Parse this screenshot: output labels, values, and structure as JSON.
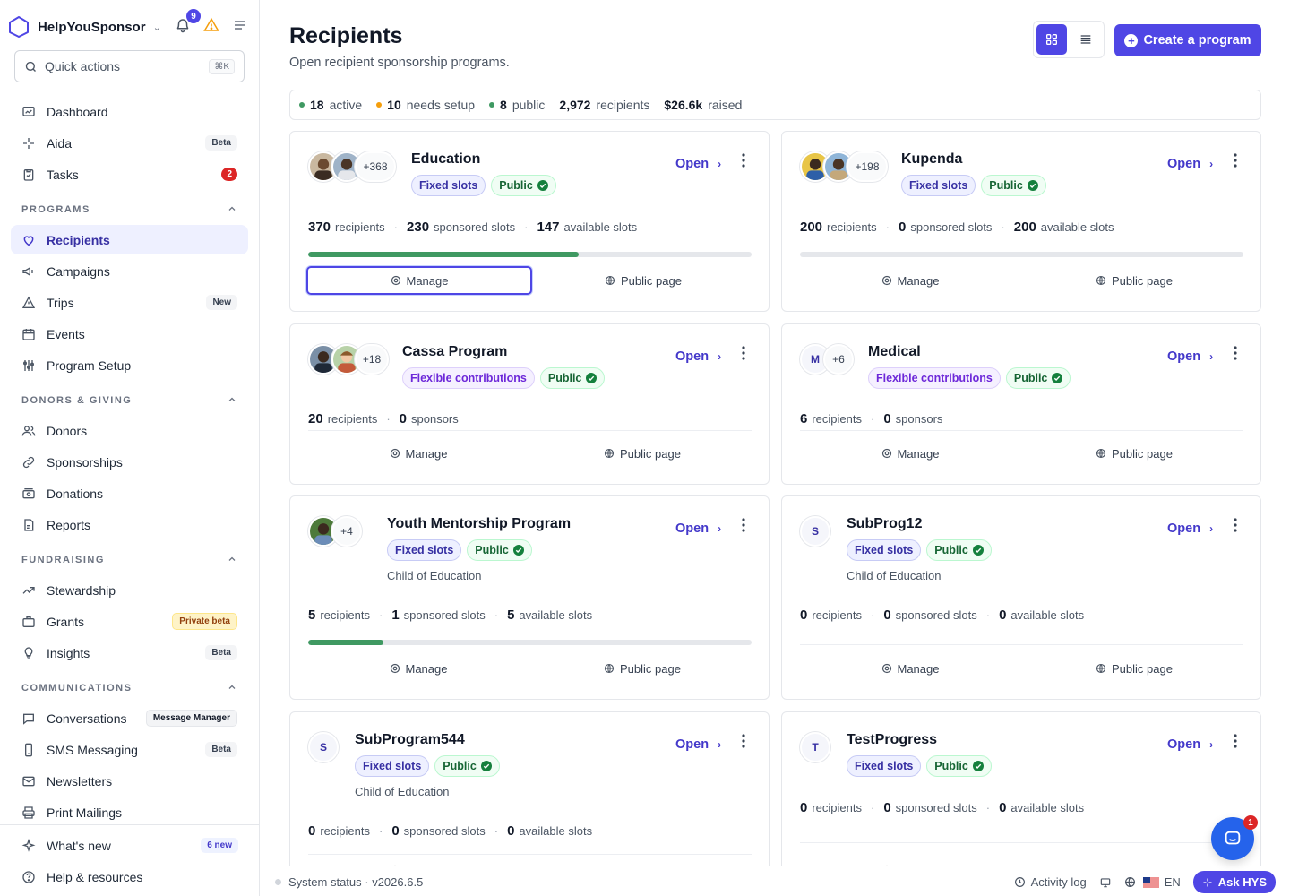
{
  "brand": {
    "name": "HelpYouSponsor",
    "notifications": "9"
  },
  "quick": {
    "placeholder": "Quick actions",
    "shortcut": "⌘K"
  },
  "nav": {
    "dashboard": "Dashboard",
    "aida": "Aida",
    "aida_badge": "Beta",
    "tasks": "Tasks",
    "tasks_count": "2",
    "programs_header": "PROGRAMS",
    "recipients": "Recipients",
    "campaigns": "Campaigns",
    "trips": "Trips",
    "trips_badge": "New",
    "events": "Events",
    "program_setup": "Program Setup",
    "donors_header": "DONORS & GIVING",
    "donors": "Donors",
    "sponsorships": "Sponsorships",
    "donations": "Donations",
    "reports": "Reports",
    "fundraising_header": "FUNDRAISING",
    "stewardship": "Stewardship",
    "grants": "Grants",
    "grants_badge": "Private beta",
    "insights": "Insights",
    "insights_badge": "Beta",
    "communications_header": "COMMUNICATIONS",
    "conversations": "Conversations",
    "conversations_badge": "Message Manager",
    "sms": "SMS Messaging",
    "sms_badge": "Beta",
    "newsletters": "Newsletters",
    "print_mailings": "Print Mailings",
    "whats_new": "What's new",
    "whats_new_badge": "6 new",
    "help": "Help & resources"
  },
  "page": {
    "title": "Recipients",
    "subtitle": "Open recipient sponsorship programs.",
    "create_label": "Create a program"
  },
  "stats": {
    "active_count": "18",
    "active_label": "active",
    "setup_count": "10",
    "setup_label": "needs setup",
    "public_count": "8",
    "public_label": "public",
    "recipients_count": "2,972",
    "recipients_label": "recipients",
    "raised_amount": "$26.6k",
    "raised_label": "raised"
  },
  "colors": {
    "accent": "#4f46e5",
    "progress": "#3f9962",
    "active_dot": "#3f9962",
    "setup_dot": "#f59e0b",
    "public_dot": "#3f9962"
  },
  "labels": {
    "open": "Open",
    "manage": "Manage",
    "public_page": "Public page",
    "fixed_slots": "Fixed slots",
    "flexible": "Flexible contributions",
    "public": "Public",
    "recipients": "recipients",
    "sponsored_slots": "sponsored slots",
    "available_slots": "available slots",
    "sponsors": "sponsors"
  },
  "cards": [
    {
      "title": "Education",
      "more": "+368",
      "recipients": "370",
      "sponsored": "230",
      "available": "147",
      "progress": 0.61
    },
    {
      "title": "Kupenda",
      "more": "+198",
      "recipients": "200",
      "sponsored": "0",
      "available": "200",
      "progress": 0
    },
    {
      "title": "Cassa Program",
      "more": "+18",
      "recipients": "20",
      "sponsors": "0"
    },
    {
      "title": "Medical",
      "letter": "M",
      "more": "+6",
      "recipients": "6",
      "sponsors": "0"
    },
    {
      "title": "Youth Mentorship Program",
      "more": "+4",
      "child_of": "Child of Education",
      "recipients": "5",
      "sponsored": "1",
      "available": "5",
      "progress": 0.17
    },
    {
      "title": "SubProg12",
      "letter": "S",
      "child_of": "Child of Education",
      "recipients": "0",
      "sponsored": "0",
      "available": "0"
    },
    {
      "title": "SubProgram544",
      "letter": "S",
      "child_of": "Child of Education",
      "recipients": "0",
      "sponsored": "0",
      "available": "0"
    },
    {
      "title": "TestProgress",
      "letter": "T",
      "recipients": "0",
      "sponsored": "0",
      "available": "0"
    }
  ],
  "footer": {
    "system_status": "System status · v2026.6.5",
    "activity_log": "Activity log",
    "lang": "EN",
    "ask": "Ask HYS",
    "chat_count": "1"
  }
}
